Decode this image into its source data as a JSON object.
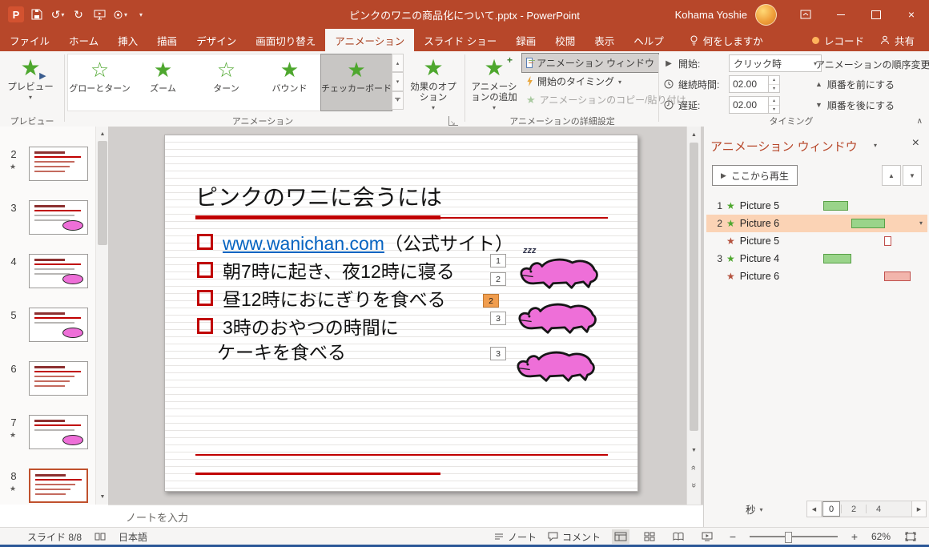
{
  "titlebar": {
    "title": "ピンクのワニの商品化について.pptx  -  PowerPoint",
    "user_name": "Kohama Yoshie"
  },
  "ribbon": {
    "tabs": [
      "ファイル",
      "ホーム",
      "挿入",
      "描画",
      "デザイン",
      "画面切り替え",
      "アニメーション",
      "スライド ショー",
      "録画",
      "校閲",
      "表示",
      "ヘルプ"
    ],
    "active_tab": "アニメーション",
    "tell_me": "何をしますか",
    "record_label": "レコード",
    "share_label": "共有",
    "preview": {
      "label": "プレビュー",
      "group_label": "プレビュー"
    },
    "gallery": {
      "items": [
        "グローとターン",
        "ズーム",
        "ターン",
        "バウンド",
        "チェッカーボード"
      ],
      "selected_item": "チェッカーボード",
      "group_label": "アニメーション"
    },
    "effect_options_label": "効果のオプション",
    "advanced": {
      "group_label": "アニメーションの詳細設定",
      "add_animation": "アニメーションの追加",
      "animation_pane": "アニメーション ウィンドウ",
      "trigger": "開始のタイミング",
      "animation_painter": "アニメーションのコピー/貼り付け"
    },
    "timing": {
      "group_label": "タイミング",
      "start_label": "開始:",
      "start_value": "クリック時",
      "duration_label": "継続時間:",
      "duration_value": "02.00",
      "delay_label": "遅延:",
      "delay_value": "02.00",
      "reorder_header": "アニメーションの順序変更",
      "move_earlier": "順番を前にする",
      "move_later": "順番を後にする"
    }
  },
  "thumbnails": {
    "slides": [
      {
        "number": "2",
        "has_star": true
      },
      {
        "number": "3",
        "has_star": false
      },
      {
        "number": "4",
        "has_star": false
      },
      {
        "number": "5",
        "has_star": false
      },
      {
        "number": "6",
        "has_star": false
      },
      {
        "number": "7",
        "has_star": true
      },
      {
        "number": "8",
        "has_star": true,
        "selected": true
      }
    ]
  },
  "slide": {
    "title": "ピンクのワニに会うには",
    "bullets": [
      {
        "link_text": "www.wanichan.com",
        "suffix": "（公式サイト）"
      },
      {
        "text": "朝7時に起き、夜12時に寝る"
      },
      {
        "text": "昼12時におにぎりを食べる"
      },
      {
        "text": "3時のおやつの時間に"
      },
      {
        "text": "ケーキを食べる"
      }
    ],
    "sleep_text": "zzz",
    "animation_badges": [
      "1",
      "2",
      "2",
      "3",
      "3"
    ]
  },
  "notes": {
    "placeholder": "ノートを入力"
  },
  "animation_pane": {
    "title": "アニメーション ウィンドウ",
    "play_from": "ここから再生",
    "items": [
      {
        "order": "1",
        "name": "Picture 5",
        "effect": "entrance",
        "selected": false
      },
      {
        "order": "2",
        "name": "Picture 6",
        "effect": "entrance",
        "selected": true
      },
      {
        "order": "",
        "name": "Picture 5",
        "effect": "exit",
        "selected": false
      },
      {
        "order": "3",
        "name": "Picture 4",
        "effect": "entrance",
        "selected": false
      },
      {
        "order": "",
        "name": "Picture 6",
        "effect": "exit",
        "selected": false
      }
    ],
    "seconds_label": "秒",
    "timeline_ticks": [
      "0",
      "2",
      "4"
    ]
  },
  "statusbar": {
    "slide_indicator": "スライド 8/8",
    "language": "日本語",
    "notes_label": "ノート",
    "comments_label": "コメント",
    "zoom_percent": "62%"
  },
  "icons": {
    "app_letter": "P",
    "save-icon": "svg-floppy",
    "undo": "↺",
    "redo": "↻",
    "slideshow-icon": "svg-monitor",
    "touch-mode-icon": "svg-circle",
    "caret_down": "▾",
    "caret_up": "▴",
    "tri_up": "▲",
    "tri_down": "▼",
    "tri_left": "◀",
    "tri_right": "▶",
    "play": "▶",
    "star": "★",
    "star_outline": "☆",
    "close": "×",
    "chevron_up": "∧",
    "dbl_chevron": "»",
    "lightning-icon": "css-bolt",
    "clock-icon": "svg-clock",
    "comment-icon": "svg-bubble",
    "notes-icon": "svg-lines",
    "proofing-icon": "svg-book",
    "minus": "−",
    "plus": "+"
  },
  "colors": {
    "accent": "#b7472a",
    "entrance_effect": "#58a046",
    "exit_effect": "#c0504d",
    "selected_row": "#fbd3b5",
    "active_badge": "#f09d4e",
    "hyperlink": "#0563c1",
    "slide_accent": "#c00000",
    "crocodile_pink": "#ee6fd8"
  }
}
